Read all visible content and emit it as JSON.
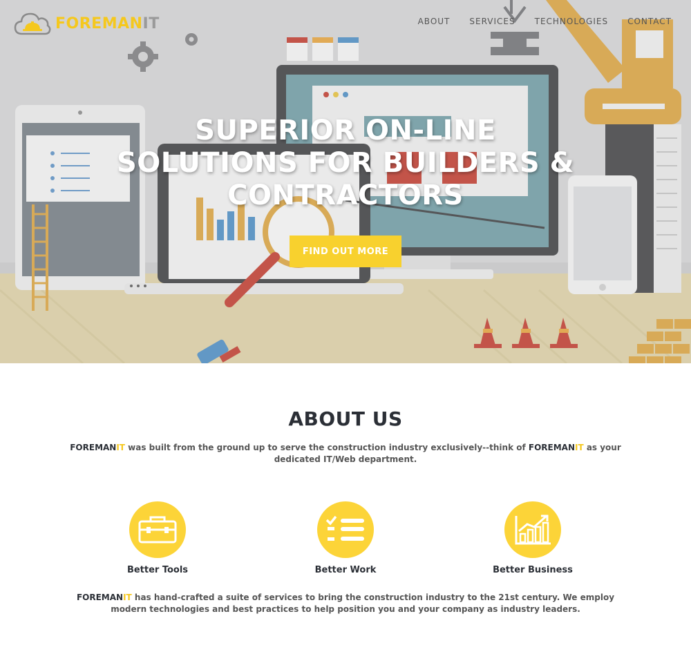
{
  "brand": {
    "name_part1": "FOREMAN",
    "name_part2": "IT"
  },
  "nav": {
    "items": [
      "ABOUT",
      "SERVICES",
      "TECHNOLOGIES",
      "CONTACT"
    ]
  },
  "hero": {
    "title_lines": [
      "SUPERIOR ON-LINE",
      "SOLUTIONS FOR BUILDERS &",
      "CONTRACTORS"
    ],
    "cta_label": "FIND OUT MORE"
  },
  "about": {
    "title": "ABOUT US",
    "intro_part1": " was built from the ground up to serve the construction industry exclusively--think of ",
    "intro_part2": " as your dedicated IT/Web department.",
    "features": [
      {
        "label": "Better Tools",
        "icon": "toolbox-icon"
      },
      {
        "label": "Better Work",
        "icon": "checklist-icon"
      },
      {
        "label": "Better Business",
        "icon": "growth-chart-icon"
      }
    ],
    "closing_part1": " has hand-crafted a suite of services to bring the construction industry to the 21st century. We employ modern technologies and best practices to help position you and your company as industry leaders."
  },
  "colors": {
    "accent": "#f8d12e",
    "dark": "#2b2f36",
    "hero_bg": "#d2d2d4"
  }
}
